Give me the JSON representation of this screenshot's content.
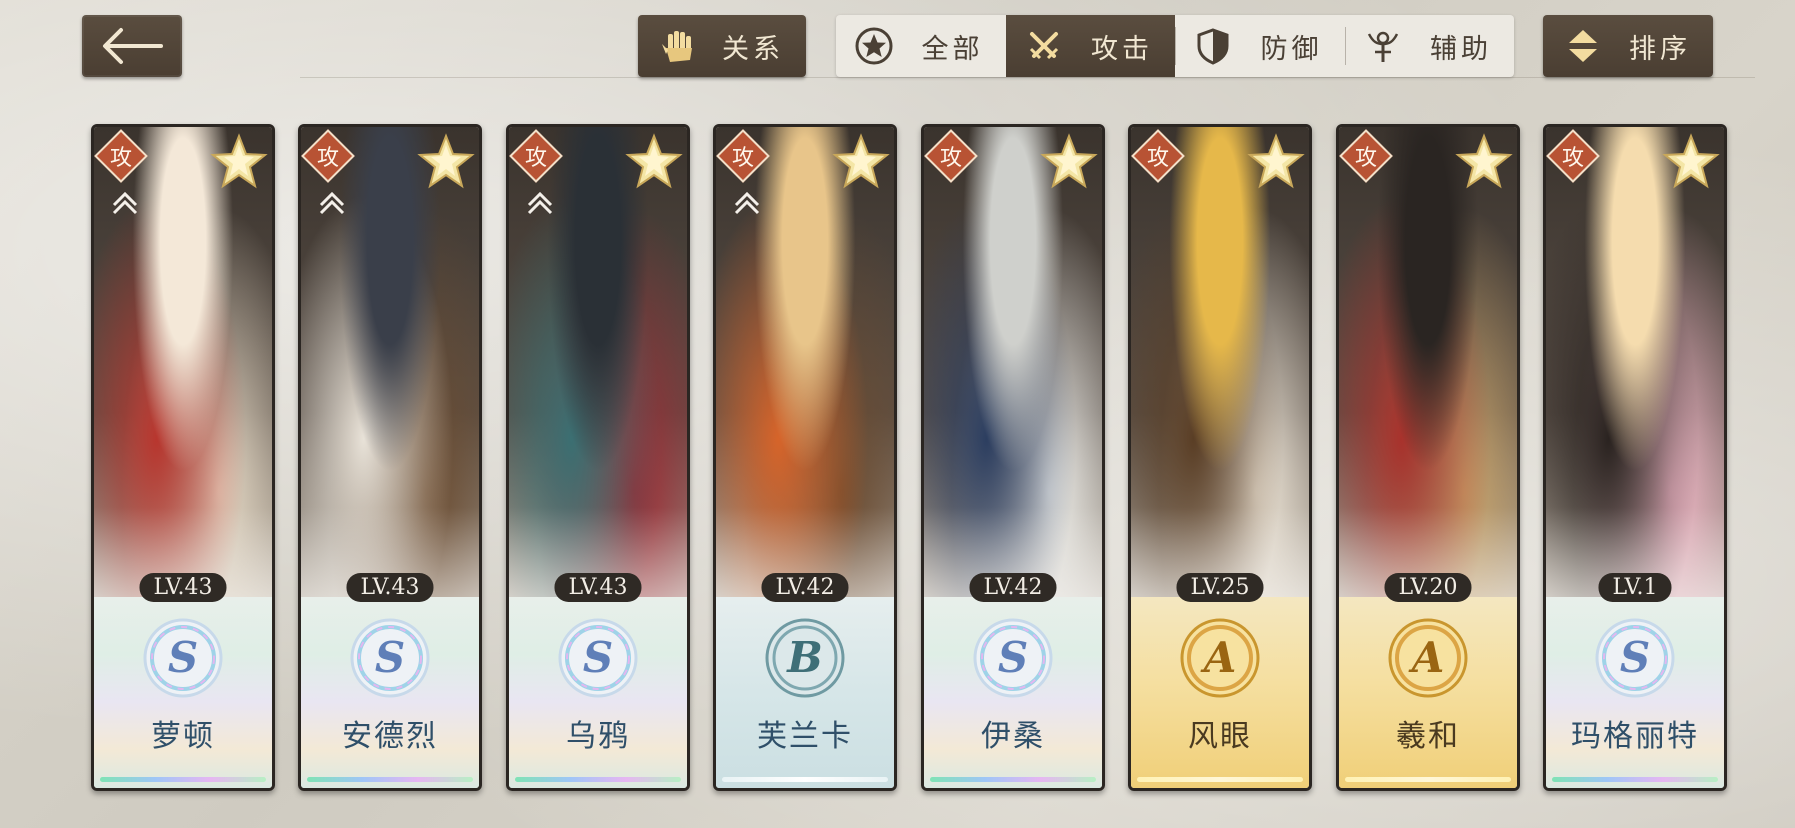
{
  "header": {
    "relation_label": "关系",
    "sort_label": "排序",
    "filters": [
      {
        "label": "全部",
        "icon": "star-circle-icon",
        "active": false
      },
      {
        "label": "攻击",
        "icon": "crossed-swords-icon",
        "active": true
      },
      {
        "label": "防御",
        "icon": "shield-icon",
        "active": false
      },
      {
        "label": "辅助",
        "icon": "support-staff-icon",
        "active": false
      }
    ]
  },
  "characters": [
    {
      "name": "萝顿",
      "level": "LV.43",
      "rank": "S",
      "type": "攻",
      "linked": true,
      "colors": [
        "#f4e8d8",
        "#b8362e",
        "#e8dcc8"
      ]
    },
    {
      "name": "安德烈",
      "level": "LV.43",
      "rank": "S",
      "type": "攻",
      "linked": true,
      "colors": [
        "#3a3f4a",
        "#e8e2d8",
        "#6a4a2e"
      ]
    },
    {
      "name": "乌鸦",
      "level": "LV.43",
      "rank": "S",
      "type": "攻",
      "linked": true,
      "colors": [
        "#2a3036",
        "#3b6f72",
        "#9b2a33"
      ]
    },
    {
      "name": "芙兰卡",
      "level": "LV.42",
      "rank": "B",
      "type": "攻",
      "linked": true,
      "colors": [
        "#e8c58a",
        "#d6642a",
        "#6b4a2e"
      ]
    },
    {
      "name": "伊桑",
      "level": "LV.42",
      "rank": "S",
      "type": "攻",
      "linked": false,
      "colors": [
        "#cfd0cc",
        "#2c3e60",
        "#f2f2ee"
      ]
    },
    {
      "name": "风眼",
      "level": "LV.25",
      "rank": "A",
      "type": "攻",
      "linked": false,
      "colors": [
        "#e6b84a",
        "#5a3e25",
        "#f2eadc"
      ]
    },
    {
      "name": "羲和",
      "level": "LV.20",
      "rank": "A",
      "type": "攻",
      "linked": false,
      "colors": [
        "#2a2522",
        "#a8322c",
        "#c9a46a"
      ]
    },
    {
      "name": "玛格丽特",
      "level": "LV.1",
      "rank": "S",
      "type": "攻",
      "linked": false,
      "colors": [
        "#f5dcae",
        "#2a2320",
        "#f2b8c8"
      ]
    }
  ]
}
